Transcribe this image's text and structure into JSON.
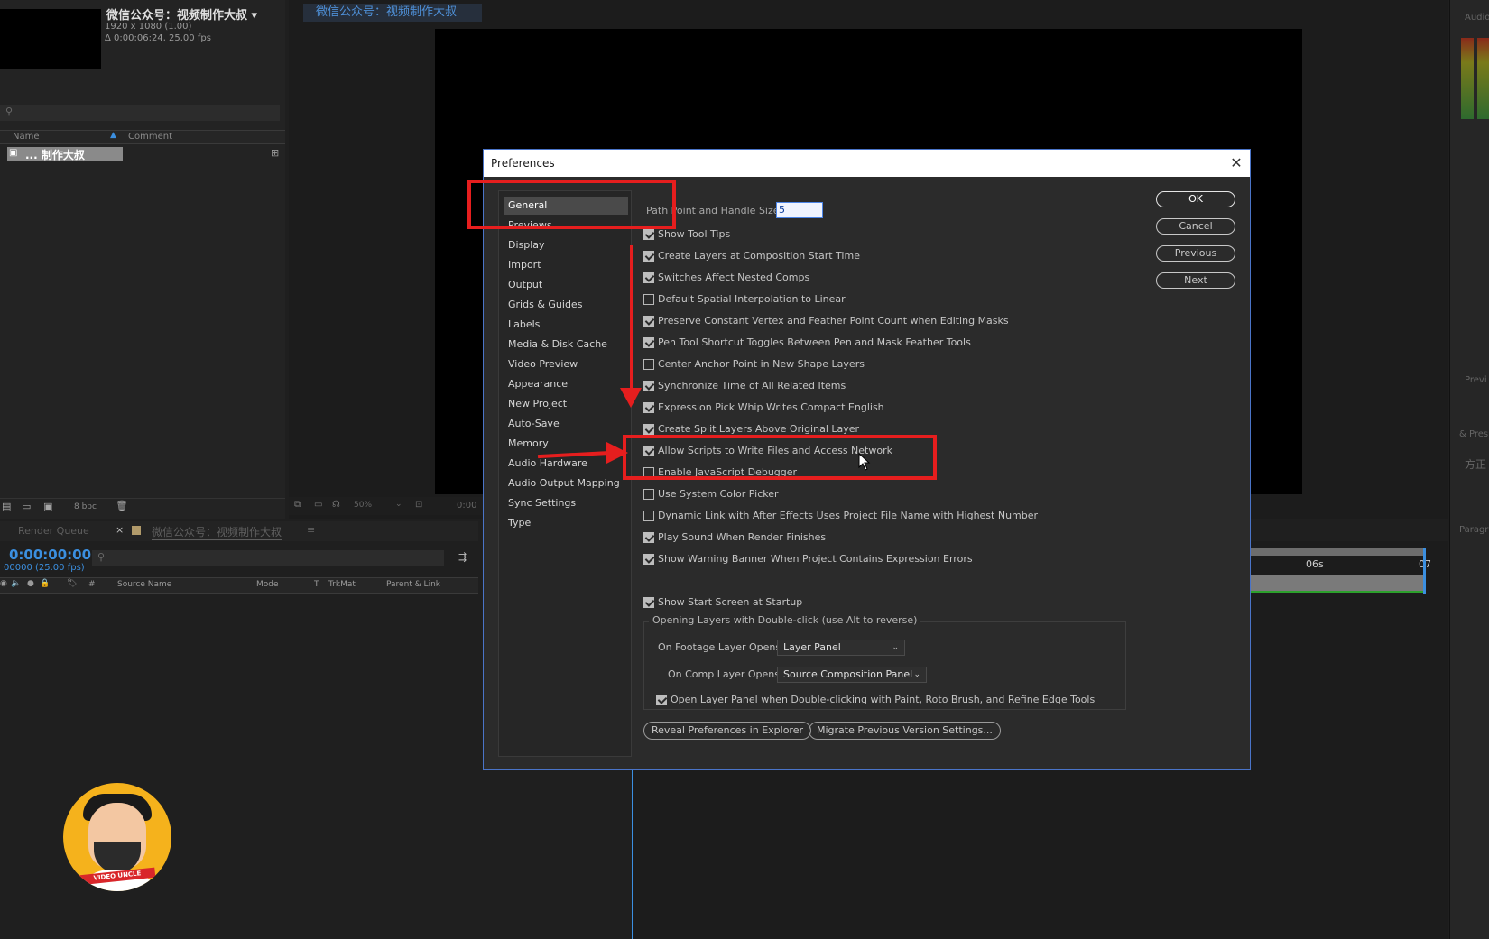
{
  "project": {
    "comp_name": "微信公众号：视频制作大叔",
    "comp_resolution": "1920 x 1080 (1.00)",
    "comp_duration": "Δ 0:00:06:24, 25.00 fps",
    "col_name": "Name",
    "col_comment": "Comment",
    "item_name": "... 制作大叔",
    "bpc": "8 bpc"
  },
  "viewer": {
    "tab_label": "微信公众号：视频制作大叔",
    "zoom": "50%",
    "time_preview": "0:00"
  },
  "timeline": {
    "tab_render_queue": "Render Queue",
    "tab_comp": "微信公众号：视频制作大叔",
    "current_time": "0:00:00:00",
    "frame_info": "00000 (25.00 fps)",
    "col_source": "Source Name",
    "col_mode": "Mode",
    "col_t": "T",
    "col_trkmat": "TrkMat",
    "col_parent": "Parent & Link",
    "marker_06": "06s",
    "marker_07": "07"
  },
  "right_panel": {
    "audio": "Audio",
    "preview": "Previ",
    "effects": "& Pres",
    "paragraph": "Paragr",
    "chinese": "方正"
  },
  "dialog": {
    "title": "Preferences",
    "categories": [
      "General",
      "Previews",
      "Display",
      "Import",
      "Output",
      "Grids & Guides",
      "Labels",
      "Media & Disk Cache",
      "Video Preview",
      "Appearance",
      "New Project",
      "Auto-Save",
      "Memory",
      "Audio Hardware",
      "Audio Output Mapping",
      "Sync Settings",
      "Type"
    ],
    "selected_category": "General",
    "path_label": "Path Point and Handle Size:",
    "path_value": "5",
    "options": [
      {
        "label": "Show Tool Tips",
        "checked": true
      },
      {
        "label": "Create Layers at Composition Start Time",
        "checked": true
      },
      {
        "label": "Switches Affect Nested Comps",
        "checked": true
      },
      {
        "label": "Default Spatial Interpolation to Linear",
        "checked": false
      },
      {
        "label": "Preserve Constant Vertex and Feather Point Count when Editing Masks",
        "checked": true
      },
      {
        "label": "Pen Tool Shortcut Toggles Between Pen and Mask Feather Tools",
        "checked": true
      },
      {
        "label": "Center Anchor Point in New Shape Layers",
        "checked": false
      },
      {
        "label": "Synchronize Time of All Related Items",
        "checked": true
      },
      {
        "label": "Expression Pick Whip Writes Compact English",
        "checked": true
      },
      {
        "label": "Create Split Layers Above Original Layer",
        "checked": true
      },
      {
        "label": "Allow Scripts to Write Files and Access Network",
        "checked": true
      },
      {
        "label": "Enable JavaScript Debugger",
        "checked": false
      },
      {
        "label": "Use System Color Picker",
        "checked": false
      },
      {
        "label": "Dynamic Link with After Effects Uses Project File Name with Highest Number",
        "checked": false
      },
      {
        "label": "Play Sound When Render Finishes",
        "checked": true
      },
      {
        "label": "Show Warning Banner When Project Contains Expression Errors",
        "checked": true
      },
      {
        "label": "Show Start Screen at Startup",
        "checked": true
      }
    ],
    "group_title": "Opening Layers with Double-click (use Alt to reverse)",
    "footage_label": "On Footage Layer Opens:",
    "footage_value": "Layer Panel",
    "comp_label": "On Comp Layer Opens:",
    "comp_value": "Source Composition Panel",
    "open_layer_panel": "Open Layer Panel when Double-clicking with Paint, Roto Brush, and Refine Edge Tools",
    "reveal_button": "Reveal Preferences in Explorer",
    "migrate_button": "Migrate Previous Version Settings...",
    "ok": "OK",
    "cancel": "Cancel",
    "previous": "Previous",
    "next": "Next"
  },
  "avatar_tag": "VIDEO UNCLE",
  "colors": {
    "accent": "#3b8fe0",
    "annotation": "#e61e1e",
    "dialog_border": "#4a74c8"
  }
}
